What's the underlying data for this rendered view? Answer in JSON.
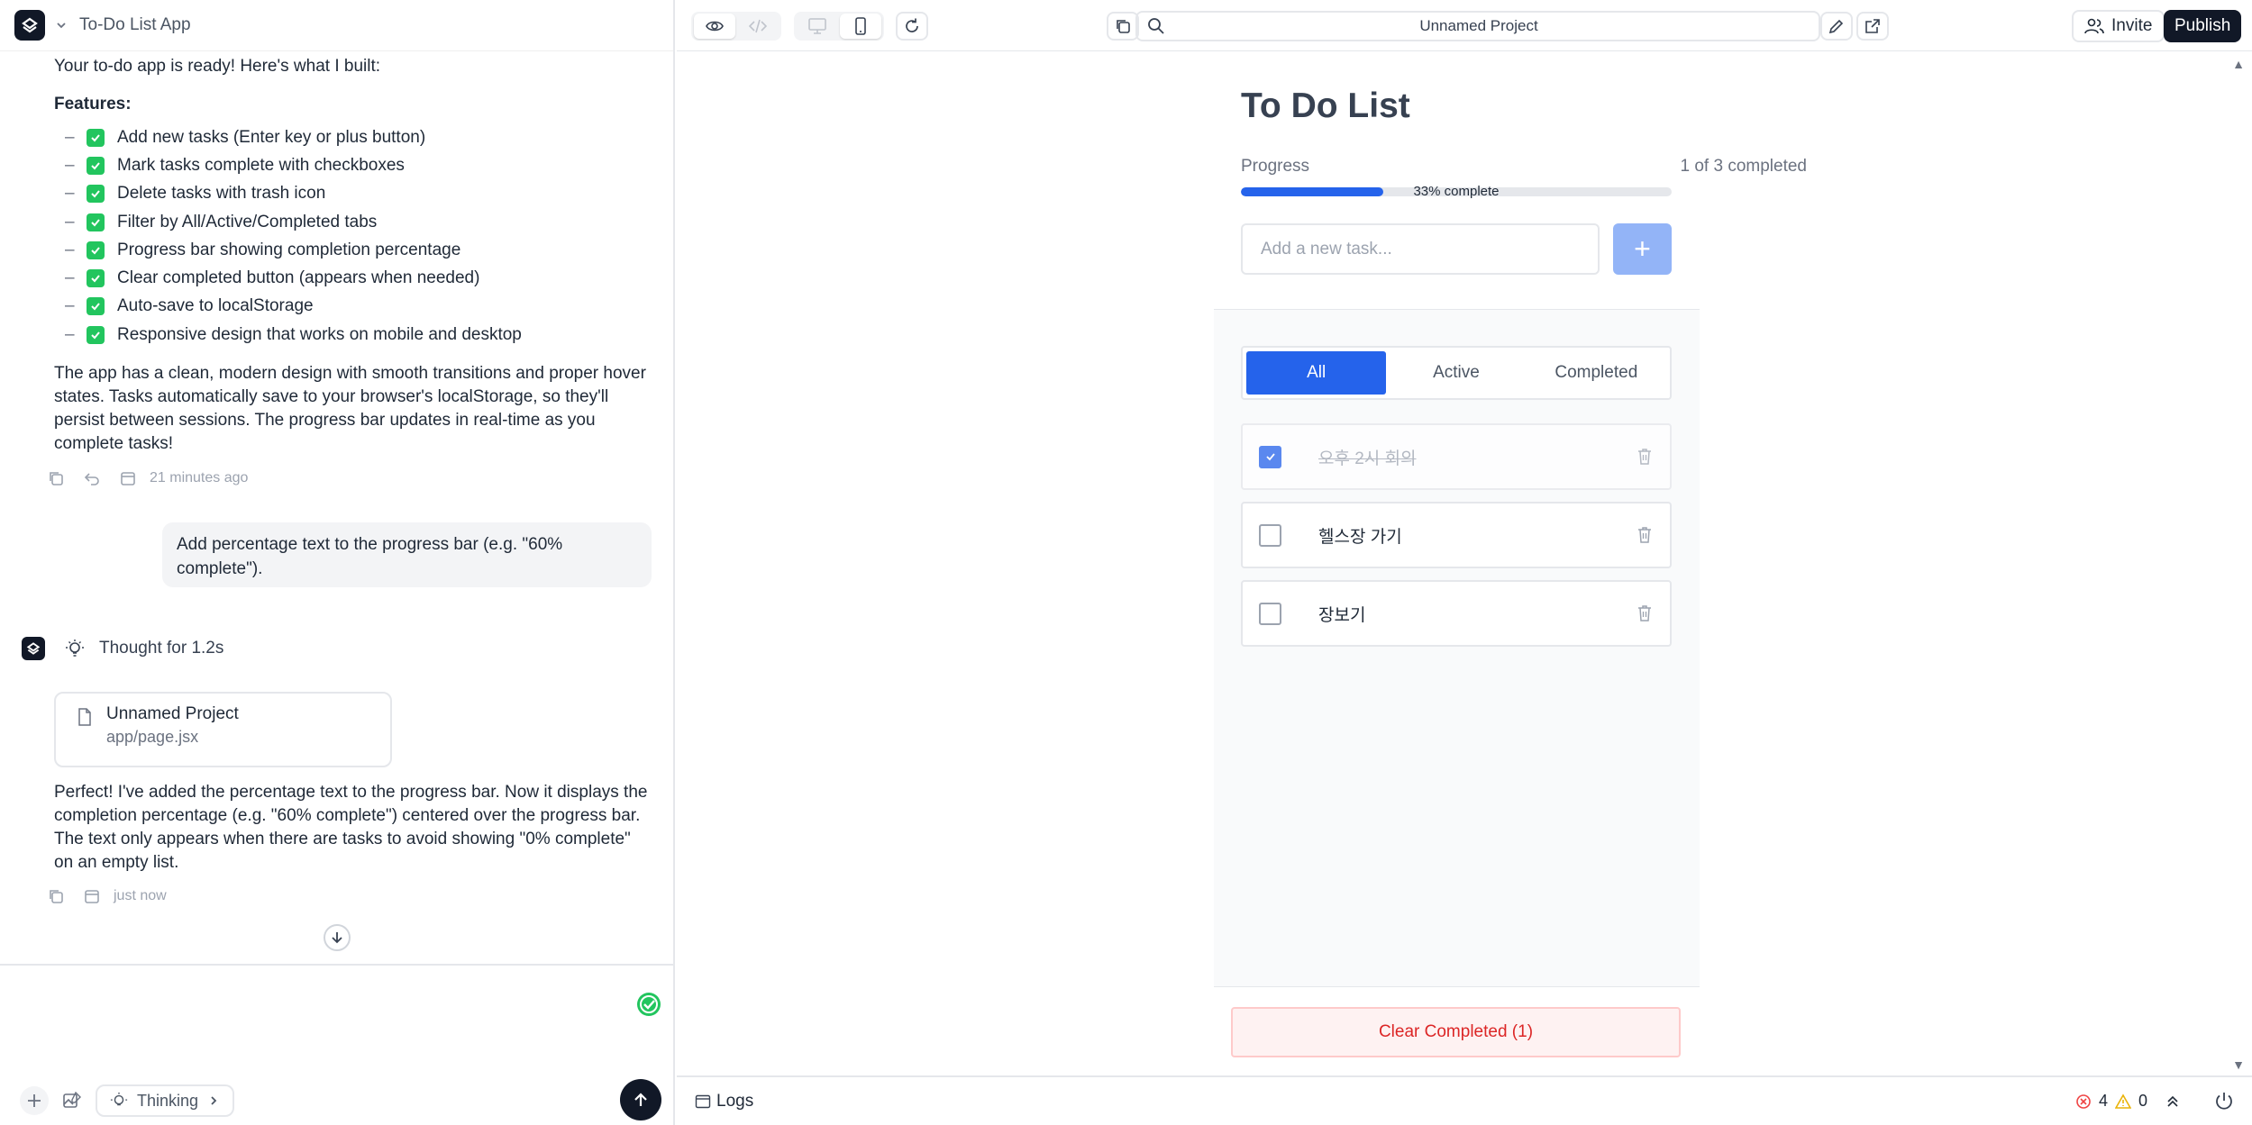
{
  "app": {
    "title": "To-Do List App"
  },
  "chat": {
    "intro": "Your to-do app is ready! Here's what I built:",
    "features_heading": "Features:",
    "features": [
      "Add new tasks (Enter key or plus button)",
      "Mark tasks complete with checkboxes",
      "Delete tasks with trash icon",
      "Filter by All/Active/Completed tabs",
      "Progress bar showing completion percentage",
      "Clear completed button (appears when needed)",
      "Auto-save to localStorage",
      "Responsive design that works on mobile and desktop"
    ],
    "summary": "The app has a clean, modern design with smooth transitions and proper hover states. Tasks automatically save to your browser's localStorage, so they'll persist between sessions. The progress bar updates in real-time as you complete tasks!",
    "summary_time": "21 minutes ago",
    "user_message": "Add percentage text to the progress bar (e.g. \"60% complete\").",
    "thought": "Thought for 1.2s",
    "file_card": {
      "name": "Unnamed Project",
      "path": "app/page.jsx"
    },
    "reply": "Perfect! I've added the percentage text to the progress bar. Now it displays the completion percentage (e.g. \"60% complete\") centered over the progress bar. The text only appears when there are tasks to avoid showing \"0% complete\" on an empty list.",
    "reply_time": "just now"
  },
  "composer": {
    "thinking_label": "Thinking"
  },
  "toolbar": {
    "url": "Unnamed Project",
    "invite": "Invite",
    "publish": "Publish"
  },
  "todo": {
    "title": "To Do List",
    "progress_label": "Progress",
    "progress_count": "1 of 3 completed",
    "progress_fraction": 0.33,
    "progress_text": "33% complete",
    "input_placeholder": "Add a new task...",
    "add_symbol": "+",
    "tabs": [
      "All",
      "Active",
      "Completed"
    ],
    "active_tab": "All",
    "tasks": [
      {
        "text": "오후 2시 회의",
        "completed": true
      },
      {
        "text": "헬스장 가기",
        "completed": false
      },
      {
        "text": "장보기",
        "completed": false
      }
    ],
    "clear_button": "Clear Completed (1)"
  },
  "statusbar": {
    "logs": "Logs",
    "errors": "4",
    "warnings": "0"
  },
  "colors": {
    "accent": "#2563eb",
    "success": "#22c55e",
    "danger": "#dc2626",
    "dark": "#111827"
  }
}
